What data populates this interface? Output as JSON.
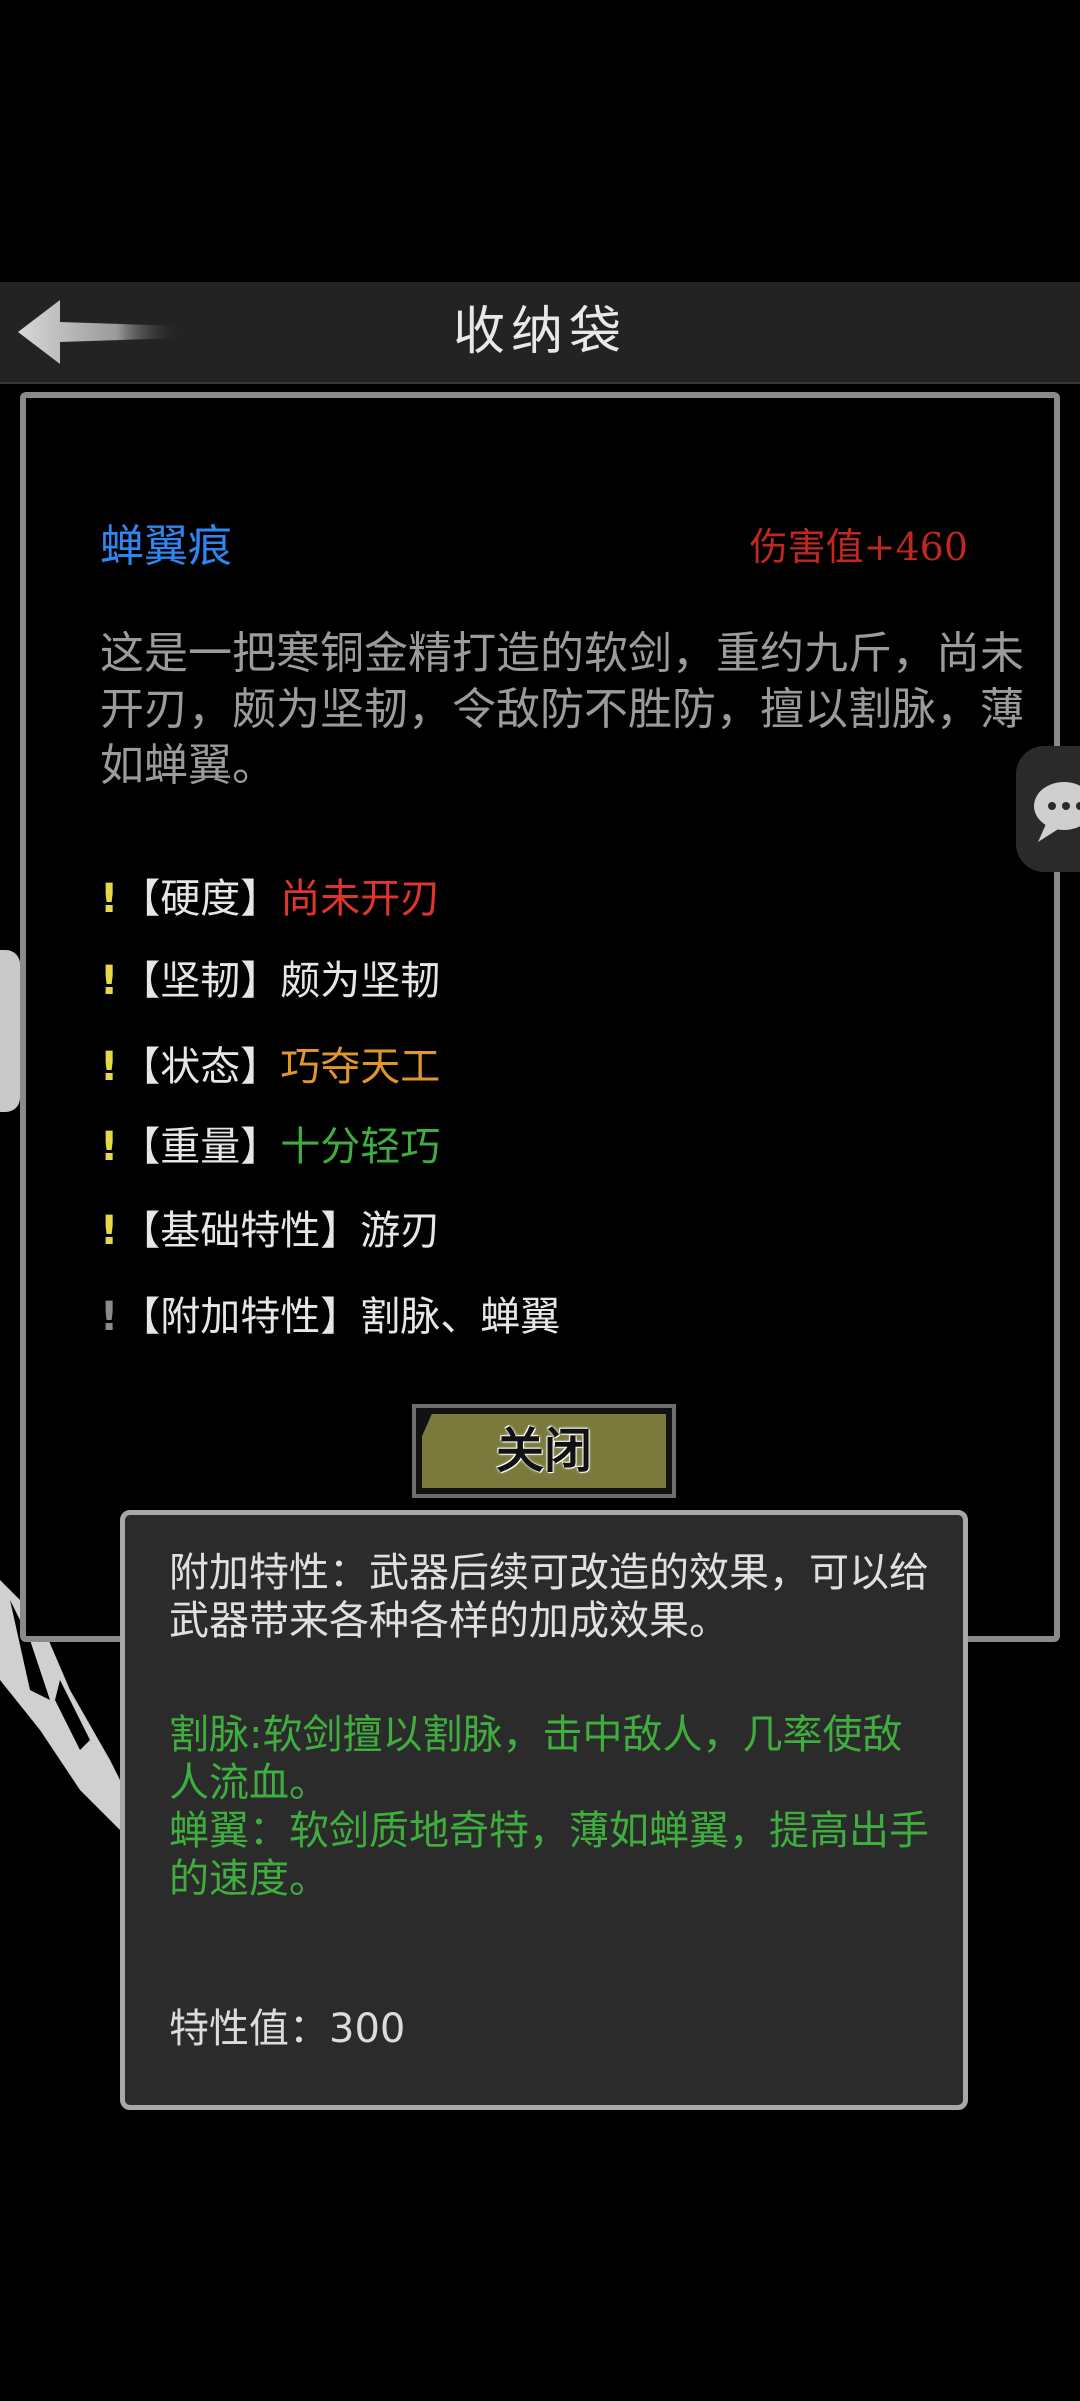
{
  "header": {
    "title": "收纳袋"
  },
  "item": {
    "name": "蝉翼痕",
    "damage": "伤害值+460",
    "description": "这是一把寒铜金精打造的软剑，重约九斤，尚未开刃，颇为坚韧，令敌防不胜防，擅以割脉，薄如蝉翼。"
  },
  "attributes": [
    {
      "bang": "!",
      "label": "【硬度】",
      "value": "尚未开刃",
      "color": "#e0352b"
    },
    {
      "bang": "!",
      "label": "【坚韧】",
      "value": "颇为坚韧",
      "color": "#e6e6e6"
    },
    {
      "bang": "!",
      "label": "【状态】",
      "value": "巧夺天工",
      "color": "#e0962c"
    },
    {
      "bang": "!",
      "label": "【重量】",
      "value": "十分轻巧",
      "color": "#3fae3f"
    },
    {
      "bang": "!",
      "label": "【基础特性】",
      "value": "游刃",
      "color": "#e6e6e6"
    },
    {
      "bang": "!",
      "label": "【附加特性】",
      "value": "割脉、蝉翼",
      "color": "#e6e6e6"
    }
  ],
  "close_button": {
    "label": "关闭"
  },
  "tooltip": {
    "description": "附加特性：武器后续可改造的效果，可以给武器带来各种各样的加成效果。",
    "effect1": "割脉:软剑擅以割脉，击中敌人，几率使敌人流血。",
    "effect2": "蝉翼：软剑质地奇特，薄如蝉翼，提高出手的速度。",
    "value": "特性值：300"
  },
  "colors": {
    "background": "#000000",
    "header": "#232323",
    "item_name": "#2f86f0",
    "damage": "#c0281f",
    "bang": "#e7d84a",
    "button": "#7b7a3c",
    "tooltip_bg": "#2b2b2b",
    "green": "#3fae3f"
  }
}
